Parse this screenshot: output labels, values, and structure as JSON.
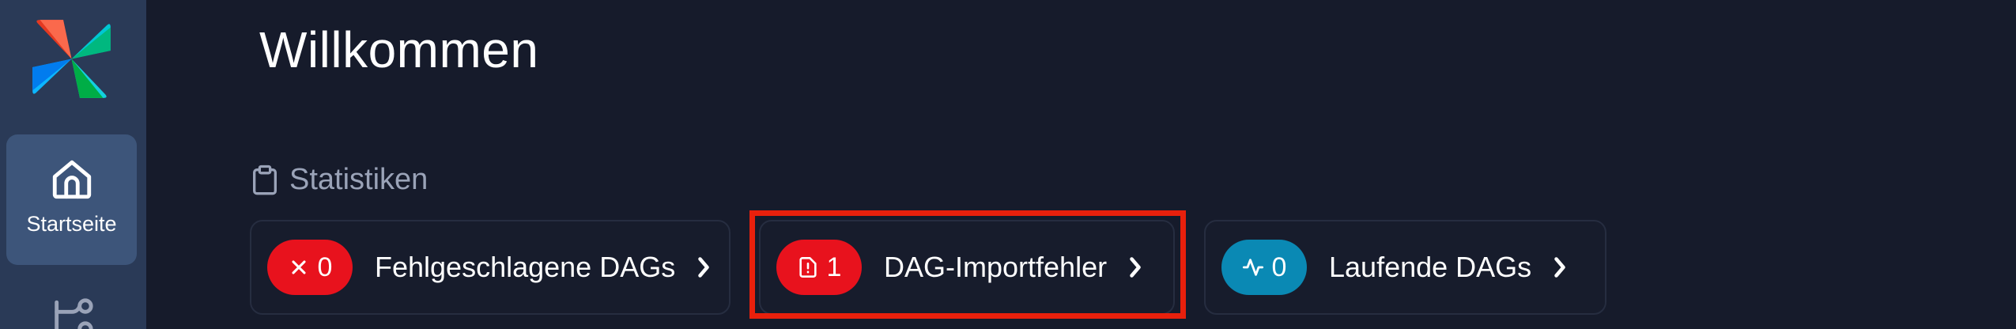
{
  "header": {
    "title": "Willkommen"
  },
  "sidebar": {
    "items": [
      {
        "label": "Startseite",
        "icon": "home-icon",
        "active": true
      },
      {
        "label": "",
        "icon": "dags-icon",
        "active": false
      }
    ]
  },
  "statistics": {
    "section_label": "Statistiken",
    "cards": [
      {
        "label": "Fehlgeschlagene DAGs",
        "count": "0",
        "icon": "x-icon",
        "badge_color": "#e8121d"
      },
      {
        "label": "DAG-Importfehler",
        "count": "1",
        "icon": "file-alert-icon",
        "badge_color": "#e8121d"
      },
      {
        "label": "Laufende DAGs",
        "count": "0",
        "icon": "activity-icon",
        "badge_color": "#0a89b4"
      }
    ]
  },
  "colors": {
    "background": "#161b2b",
    "sidebar": "#2a3a57",
    "sidebar_active": "#3d557a",
    "highlight": "#e8200c"
  }
}
